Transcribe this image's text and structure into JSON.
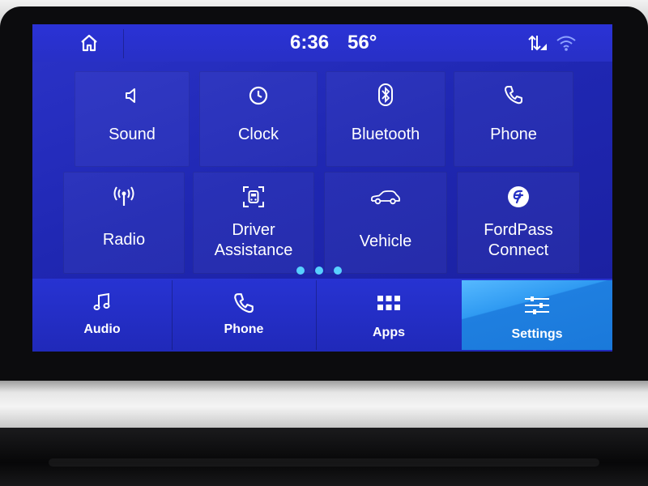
{
  "status": {
    "time": "6:36",
    "temperature": "56°"
  },
  "grid": {
    "tiles": [
      {
        "label": "Sound",
        "icon": "speaker-icon"
      },
      {
        "label": "Clock",
        "icon": "clock-icon"
      },
      {
        "label": "Bluetooth",
        "icon": "bluetooth-icon"
      },
      {
        "label": "Phone",
        "icon": "phone-icon"
      },
      {
        "label": "Radio",
        "icon": "antenna-icon"
      },
      {
        "label": "Driver\nAssistance",
        "icon": "driver-assist-icon"
      },
      {
        "label": "Vehicle",
        "icon": "car-icon"
      },
      {
        "label": "FordPass\nConnect",
        "icon": "fordpass-icon"
      }
    ],
    "page_dots": 3
  },
  "navbar": {
    "items": [
      {
        "label": "Audio",
        "icon": "music-note-icon",
        "active": false
      },
      {
        "label": "Phone",
        "icon": "phone-icon",
        "active": false
      },
      {
        "label": "Apps",
        "icon": "apps-grid-icon",
        "active": false
      },
      {
        "label": "Settings",
        "icon": "sliders-icon",
        "active": true
      }
    ]
  },
  "colors": {
    "screen_blue": "#2430c4",
    "active_tab": "#2f9af2",
    "page_dot": "#58d0ff"
  }
}
